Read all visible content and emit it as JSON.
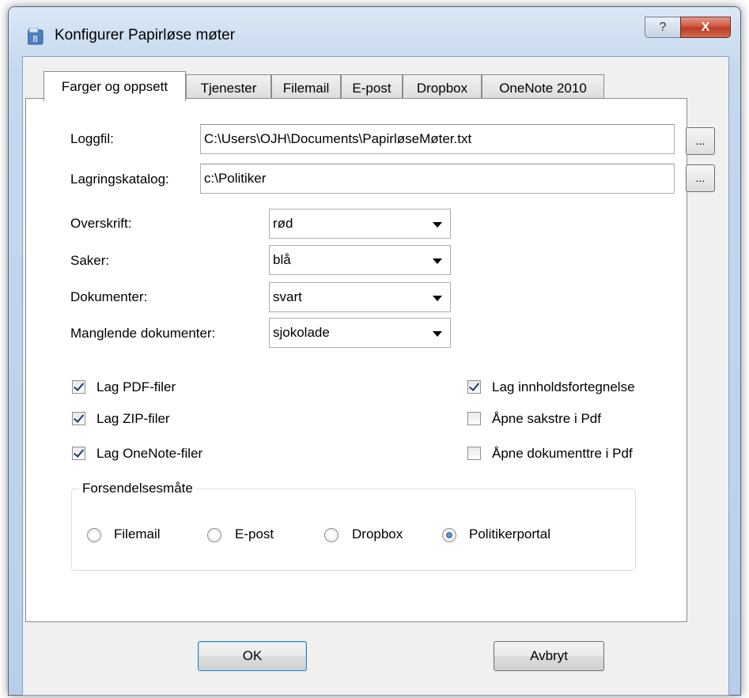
{
  "window": {
    "title": "Konfigurer Papirløse møter",
    "icon": "app-icon"
  },
  "titlebar_buttons": {
    "help": "?",
    "close": "X"
  },
  "tabs": [
    "Farger og oppsett",
    "Tjenester",
    "Filemail",
    "E-post",
    "Dropbox",
    "OneNote 2010"
  ],
  "active_tab": "Farger og oppsett",
  "logfile": {
    "label": "Loggfil:",
    "value": "C:\\Users\\OJH\\Documents\\PapirløseMøter.txt",
    "browse": "..."
  },
  "storage": {
    "label": "Lagringskatalog:",
    "value": "c:\\Politiker",
    "browse": "..."
  },
  "colors": [
    {
      "label": "Overskrift:",
      "value": "rød"
    },
    {
      "label": "Saker:",
      "value": "blå"
    },
    {
      "label": "Dokumenter:",
      "value": "svart"
    },
    {
      "label": "Manglende dokumenter:",
      "value": "sjokolade"
    }
  ],
  "options_left": [
    {
      "label": "Lag PDF-filer",
      "checked": true
    },
    {
      "label": "Lag ZIP-filer",
      "checked": true
    },
    {
      "label": "Lag OneNote-filer",
      "checked": true
    }
  ],
  "options_right": [
    {
      "label": "Lag innholdsfortegnelse",
      "checked": true
    },
    {
      "label": "Åpne sakstre i Pdf",
      "checked": false
    },
    {
      "label": "Åpne dokumenttre i Pdf",
      "checked": false
    }
  ],
  "shipping": {
    "legend": "Forsendelsesmåte",
    "options": [
      "Filemail",
      "E-post",
      "Dropbox",
      "Politikerportal"
    ],
    "selected": "Politikerportal"
  },
  "buttons": {
    "ok": "OK",
    "cancel": "Avbryt"
  }
}
